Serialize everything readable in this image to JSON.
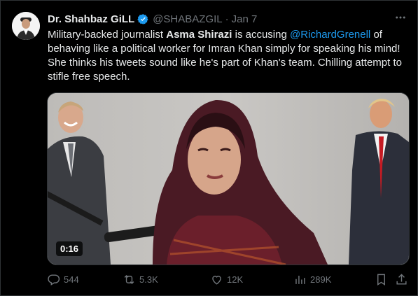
{
  "tweet": {
    "author_name": "Dr. Shahbaz GiLL",
    "handle": "@SHABAZGIL",
    "separator": "·",
    "date": "Jan 7",
    "text_parts": {
      "p1": "Military-backed journalist ",
      "bold_name": "Asma Shirazi",
      "p2": " is accusing ",
      "mention": "@RichardGrenell",
      "p3": " of behaving like a political worker for Imran Khan simply for speaking his mind! She thinks his tweets sound like he's part of Khan's team. Chilling attempt to stifle free speech."
    },
    "video_duration": "0:16",
    "more_icon": "more-icon"
  },
  "actions": {
    "replies": "544",
    "reposts": "5.3K",
    "likes": "12K",
    "views": "289K"
  },
  "colors": {
    "background": "#000000",
    "text": "#e7e9ea",
    "secondary": "#71767b",
    "accent": "#1d9bf0",
    "border": "#2f3336"
  }
}
